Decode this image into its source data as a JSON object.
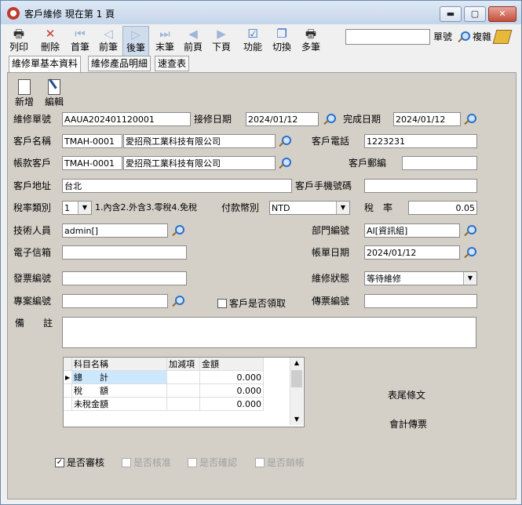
{
  "window": {
    "title": "客戶維修 現在第 1 頁",
    "minimize": "▬",
    "maximize": "▢",
    "close": "✕"
  },
  "toolbar": {
    "items": [
      {
        "label": "列印",
        "icon": "🖶"
      },
      {
        "label": "刪除",
        "icon": "✕"
      },
      {
        "label": "首筆",
        "icon": "⏮"
      },
      {
        "label": "前筆",
        "icon": "◁"
      },
      {
        "label": "後筆",
        "icon": "▷"
      },
      {
        "label": "末筆",
        "icon": "⏭"
      },
      {
        "label": "前頁",
        "icon": "◀"
      },
      {
        "label": "下頁",
        "icon": "▶"
      },
      {
        "label": "功能",
        "icon": "☑"
      },
      {
        "label": "切換",
        "icon": "❐"
      },
      {
        "label": "多筆",
        "icon": "🖶"
      }
    ],
    "search_value": "",
    "order_no_label": "單號",
    "copy_label": "複雜"
  },
  "tabs": [
    "維修單基本資料",
    "維修產品明細",
    "速查表"
  ],
  "subtoolbar": {
    "new_label": "新增",
    "edit_label": "編輯"
  },
  "form": {
    "repair_no": {
      "label": "維修單號",
      "value": "AAUA202401120001"
    },
    "receive_date": {
      "label": "接修日期",
      "value": "2024/01/12"
    },
    "finish_date": {
      "label": "完成日期",
      "value": "2024/01/12"
    },
    "customer_name": {
      "label": "客戶名稱",
      "code": "TMAH-0001",
      "name": "愛招飛工業科技有限公司"
    },
    "customer_phone": {
      "label": "客戶電話",
      "value": "1223231"
    },
    "account_customer": {
      "label": "帳款客戶",
      "code": "TMAH-0001",
      "name": "愛招飛工業科技有限公司"
    },
    "customer_postal": {
      "label": "客戶郵編",
      "value": ""
    },
    "customer_address": {
      "label": "客戶地址",
      "value": "台北"
    },
    "customer_mobile": {
      "label": "客戶手機號碼",
      "value": ""
    },
    "tax_type": {
      "label": "稅率類別",
      "value": "1",
      "hint": "1.內含2.外含3.零稅4.免稅"
    },
    "currency": {
      "label": "付款幣別",
      "value": "NTD"
    },
    "tax_rate": {
      "label": "稅　率",
      "value": "0.05"
    },
    "technician": {
      "label": "技術人員",
      "value": "admin[]"
    },
    "department": {
      "label": "部門編號",
      "value": "AI[資訊組]"
    },
    "email": {
      "label": "電子信箱",
      "value": ""
    },
    "bill_date": {
      "label": "帳單日期",
      "value": "2024/01/12"
    },
    "invoice_no": {
      "label": "發票編號",
      "value": ""
    },
    "repair_status": {
      "label": "維修狀態",
      "value": "等待維修"
    },
    "project_no": {
      "label": "專案編號",
      "value": ""
    },
    "customer_pickup": {
      "label": "客戶是否領取"
    },
    "voucher_no": {
      "label": "傳票編號",
      "value": ""
    },
    "remarks": {
      "label": "備　　註",
      "value": ""
    }
  },
  "summary_grid": {
    "headers": [
      "科目名稱",
      "加減項",
      "金額"
    ],
    "rows": [
      {
        "name": "總　　計",
        "adj": "",
        "amount": "0.000"
      },
      {
        "name": "稅　　額",
        "adj": "",
        "amount": "0.000"
      },
      {
        "name": "未稅金額",
        "adj": "",
        "amount": "0.000"
      }
    ]
  },
  "side_links": {
    "footer_terms": "表尾條文",
    "accounting_voucher": "會計傳票"
  },
  "flags": [
    {
      "label": "是否審核",
      "checked": true,
      "enabled": true
    },
    {
      "label": "是否核准",
      "checked": false,
      "enabled": false
    },
    {
      "label": "是否確認",
      "checked": false,
      "enabled": false
    },
    {
      "label": "是否銷帳",
      "checked": false,
      "enabled": false
    }
  ]
}
